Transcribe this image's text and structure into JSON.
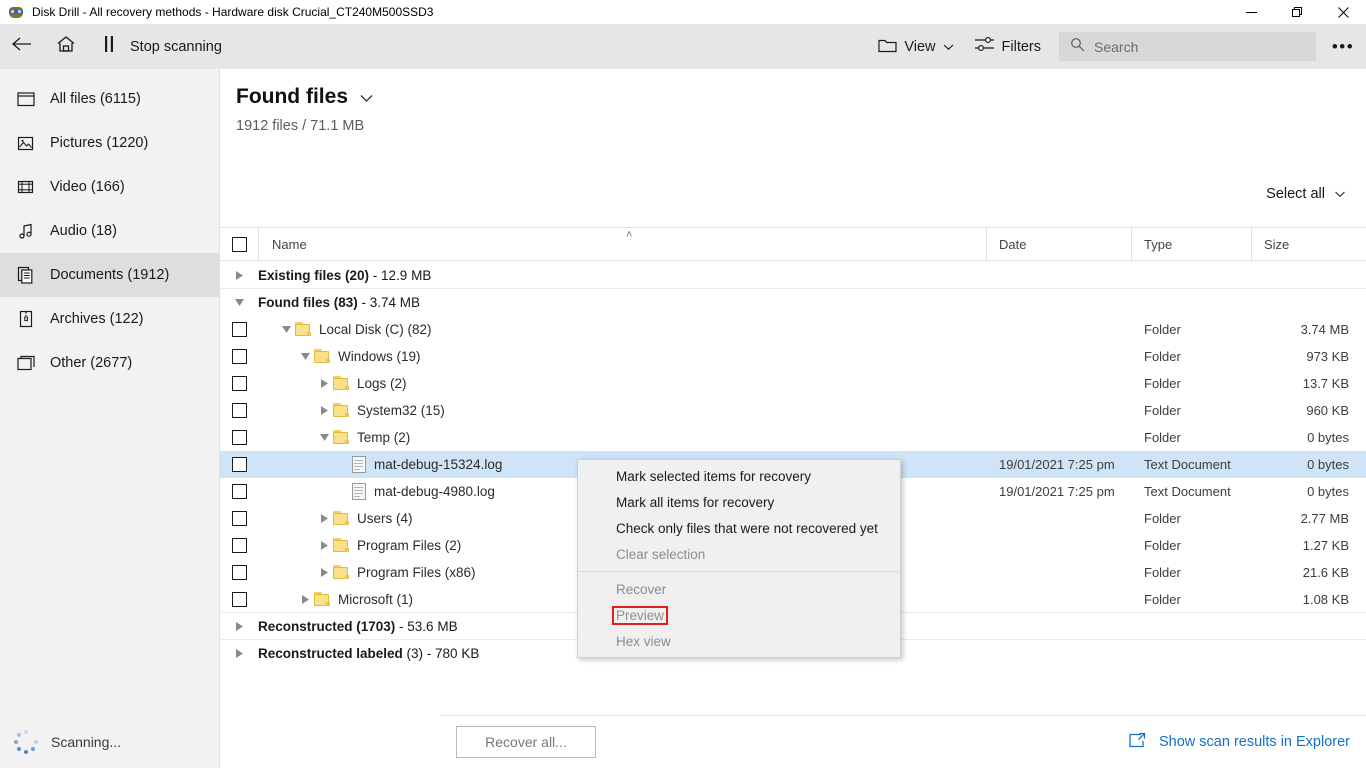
{
  "window": {
    "title": "Disk Drill - All recovery methods - Hardware disk Crucial_CT240M500SSD3",
    "app_icon": "disk-drill-logo",
    "minimize": "—",
    "maximize": "❐",
    "close": "✕"
  },
  "toolbar": {
    "back_icon": "back-arrow-icon",
    "home_icon": "home-icon",
    "pause_icon": "pause-icon",
    "stop_label": "Stop scanning",
    "view_label": "View",
    "view_icon": "folder-icon",
    "filters_label": "Filters",
    "filters_icon": "sliders-icon",
    "search_placeholder": "Search",
    "search_value": "",
    "search_icon": "search-icon",
    "more_label": "•••"
  },
  "sidebar": {
    "items": [
      {
        "label": "All files (6115)",
        "icon": "all-files-icon",
        "active": false
      },
      {
        "label": "Pictures (1220)",
        "icon": "pictures-icon",
        "active": false
      },
      {
        "label": "Video (166)",
        "icon": "video-icon",
        "active": false
      },
      {
        "label": "Audio (18)",
        "icon": "audio-icon",
        "active": false
      },
      {
        "label": "Documents (1912)",
        "icon": "documents-icon",
        "active": true
      },
      {
        "label": "Archives (122)",
        "icon": "archives-icon",
        "active": false
      },
      {
        "label": "Other (2677)",
        "icon": "other-icon",
        "active": false
      }
    ],
    "status": "Scanning...",
    "status_icon": "spinner-icon"
  },
  "content": {
    "title": "Found files",
    "title_chevron": "chevron-down-icon",
    "subtitle": "1912 files / 71.1 MB",
    "select_all": "Select all",
    "select_all_chevron": "chevron-down-icon"
  },
  "table": {
    "columns": [
      "Name",
      "Date",
      "Type",
      "Size"
    ],
    "sort_indicator": "˄",
    "rows": [
      {
        "kind": "group",
        "indent": 0,
        "twisty": "collapsed",
        "checkbox": false,
        "label": "Existing files (20)",
        "label_thin": " - 12.9 MB",
        "date": "",
        "type": "",
        "size": "",
        "selected": false,
        "border": true
      },
      {
        "kind": "group",
        "indent": 0,
        "twisty": "expanded",
        "checkbox": false,
        "label": "Found files (83)",
        "label_thin": " - 3.74 MB",
        "date": "",
        "type": "",
        "size": "",
        "selected": false,
        "border": false
      },
      {
        "kind": "folder",
        "indent": 1,
        "twisty": "expanded",
        "checkbox": true,
        "label": "Local Disk (C) (82)",
        "date": "",
        "type": "Folder",
        "size": "3.74 MB",
        "selected": false,
        "border": false
      },
      {
        "kind": "folder",
        "indent": 2,
        "twisty": "expanded",
        "checkbox": true,
        "label": "Windows (19)",
        "date": "",
        "type": "Folder",
        "size": "973 KB",
        "selected": false,
        "border": false
      },
      {
        "kind": "folder",
        "indent": 3,
        "twisty": "collapsed",
        "checkbox": true,
        "label": "Logs (2)",
        "date": "",
        "type": "Folder",
        "size": "13.7 KB",
        "selected": false,
        "border": false
      },
      {
        "kind": "folder",
        "indent": 3,
        "twisty": "collapsed",
        "checkbox": true,
        "label": "System32 (15)",
        "date": "",
        "type": "Folder",
        "size": "960 KB",
        "selected": false,
        "border": false
      },
      {
        "kind": "folder",
        "indent": 3,
        "twisty": "expanded",
        "checkbox": true,
        "label": "Temp (2)",
        "date": "",
        "type": "Folder",
        "size": "0 bytes",
        "selected": false,
        "border": false
      },
      {
        "kind": "file",
        "indent": 4,
        "twisty": "none",
        "checkbox": true,
        "label": "mat-debug-15324.log",
        "date": "19/01/2021 7:25 pm",
        "type": "Text Document",
        "size": "0 bytes",
        "selected": true,
        "border": false
      },
      {
        "kind": "file",
        "indent": 4,
        "twisty": "none",
        "checkbox": true,
        "label": "mat-debug-4980.log",
        "date": "19/01/2021 7:25 pm",
        "type": "Text Document",
        "size": "0 bytes",
        "selected": false,
        "border": false
      },
      {
        "kind": "folder",
        "indent": 3,
        "twisty": "collapsed",
        "checkbox": true,
        "label": "Users (4)",
        "date": "",
        "type": "Folder",
        "size": "2.77 MB",
        "selected": false,
        "border": false
      },
      {
        "kind": "folder",
        "indent": 3,
        "twisty": "collapsed",
        "checkbox": true,
        "label": "Program Files (2)",
        "date": "",
        "type": "Folder",
        "size": "1.27 KB",
        "selected": false,
        "border": false
      },
      {
        "kind": "folder",
        "indent": 3,
        "twisty": "collapsed",
        "checkbox": true,
        "label": "Program Files (x86)",
        "date": "",
        "type": "Folder",
        "size": "21.6 KB",
        "selected": false,
        "border": false
      },
      {
        "kind": "folder",
        "indent": 2,
        "twisty": "collapsed",
        "checkbox": true,
        "label": "Microsoft (1)",
        "date": "",
        "type": "Folder",
        "size": "1.08 KB",
        "selected": false,
        "border": true
      },
      {
        "kind": "group",
        "indent": 0,
        "twisty": "collapsed",
        "checkbox": false,
        "label": "Reconstructed (1703)",
        "label_thin": " - 53.6 MB",
        "date": "",
        "type": "",
        "size": "",
        "selected": false,
        "border": true
      },
      {
        "kind": "group",
        "indent": 0,
        "twisty": "collapsed",
        "checkbox": false,
        "label": "Reconstructed labeled",
        "label_thin": " (3) - 780 KB",
        "date": "",
        "type": "",
        "size": "",
        "selected": false,
        "border": false
      }
    ]
  },
  "context_menu": {
    "items": [
      {
        "label": "Mark selected items for recovery",
        "disabled": false,
        "highlighted": false
      },
      {
        "label": "Mark all items for recovery",
        "disabled": false,
        "highlighted": false
      },
      {
        "label": "Check only files that were not recovered yet",
        "disabled": false,
        "highlighted": false
      },
      {
        "label": "Clear selection",
        "disabled": true,
        "highlighted": false
      },
      {
        "label": "__separator__",
        "disabled": false,
        "highlighted": false
      },
      {
        "label": "Recover",
        "disabled": true,
        "highlighted": false
      },
      {
        "label": "Preview",
        "disabled": true,
        "highlighted": true
      },
      {
        "label": "Hex view",
        "disabled": true,
        "highlighted": false
      }
    ]
  },
  "bottom": {
    "recover_all": "Recover all...",
    "explorer_link": "Show scan results in Explorer",
    "explorer_icon": "open-in-explorer-icon"
  },
  "colors": {
    "accent_link": "#1370c8",
    "selection": "#cfe4f7",
    "toolbar_bg": "#e6e6e6",
    "sidebar_bg": "#f2f2f2",
    "sidebar_active": "#dedede",
    "highlight_box": "#e02020",
    "folder_yellow": "#fbe08a"
  }
}
